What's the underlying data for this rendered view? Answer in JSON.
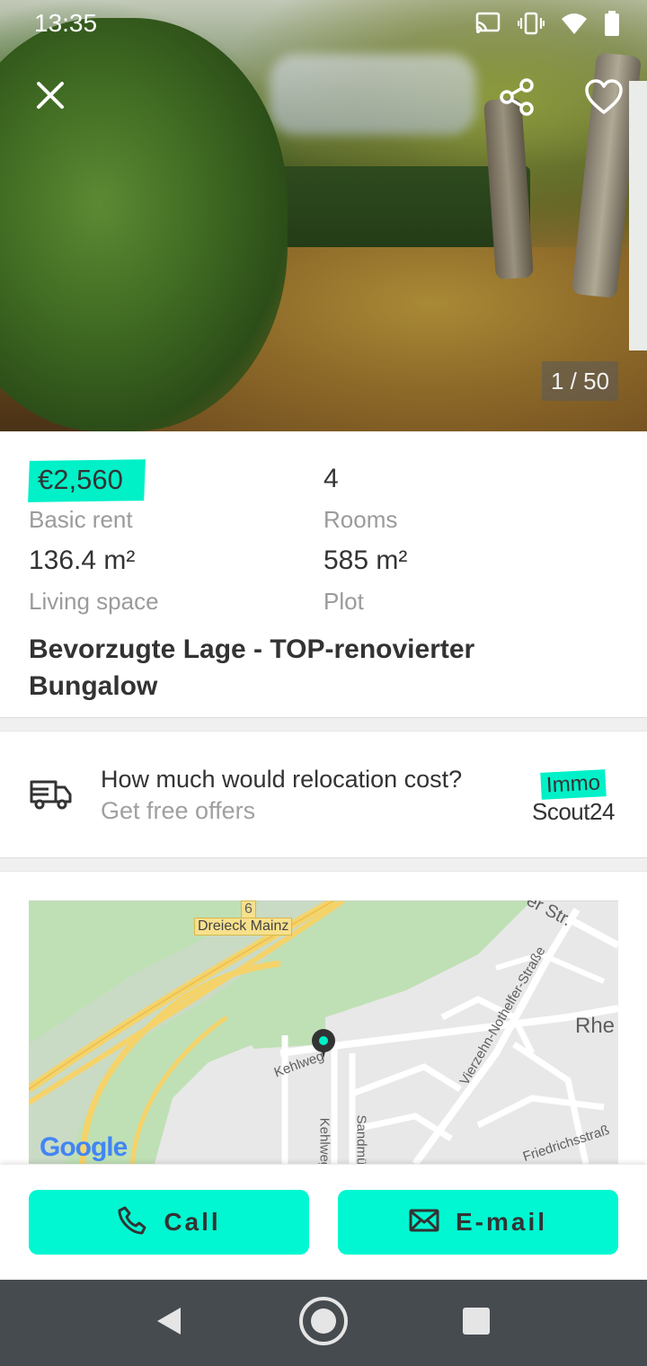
{
  "status_bar": {
    "time": "13:35"
  },
  "hero": {
    "photo_counter": "1 / 50"
  },
  "facts": {
    "price": "€2,560",
    "price_label": "Basic rent",
    "rooms": "4",
    "rooms_label": "Rooms",
    "living_space": "136.4 m²",
    "living_space_label": "Living space",
    "plot": "585 m²",
    "plot_label": "Plot",
    "title": "Bevorzugte Lage - TOP-renovierter Bungalow"
  },
  "relocation": {
    "title": "How much would relocation cost?",
    "subtitle": "Get free offers",
    "logo_top": "Immo",
    "logo_bottom": "Scout24"
  },
  "map": {
    "labels": {
      "highway_number": "6",
      "junction": "Dreieck Mainz",
      "street_str": "er Str.",
      "street_vierzehn": "Vierzehn-Nothelfer-Straße",
      "place_rhe": "Rhe",
      "street_kehlweg": "Kehlweg",
      "street_kehlweg2": "Kehlweg",
      "street_sandm": "Sandmü",
      "street_friedrich": "Friedrichsstraß",
      "google": "Google"
    }
  },
  "actions": {
    "call_label": "Call",
    "email_label": "E-mail"
  },
  "colors": {
    "accent": "#00f7d1",
    "nav_bar": "#464b50",
    "text_primary": "#333333",
    "text_secondary": "#9b9b9b"
  },
  "icons": {
    "close": "close-icon",
    "share": "share-icon",
    "favorite": "heart-icon",
    "truck": "truck-icon",
    "phone": "phone-icon",
    "mail": "mail-icon",
    "cast": "cast-icon",
    "vibrate": "vibrate-icon",
    "wifi": "wifi-icon",
    "battery": "battery-icon"
  }
}
